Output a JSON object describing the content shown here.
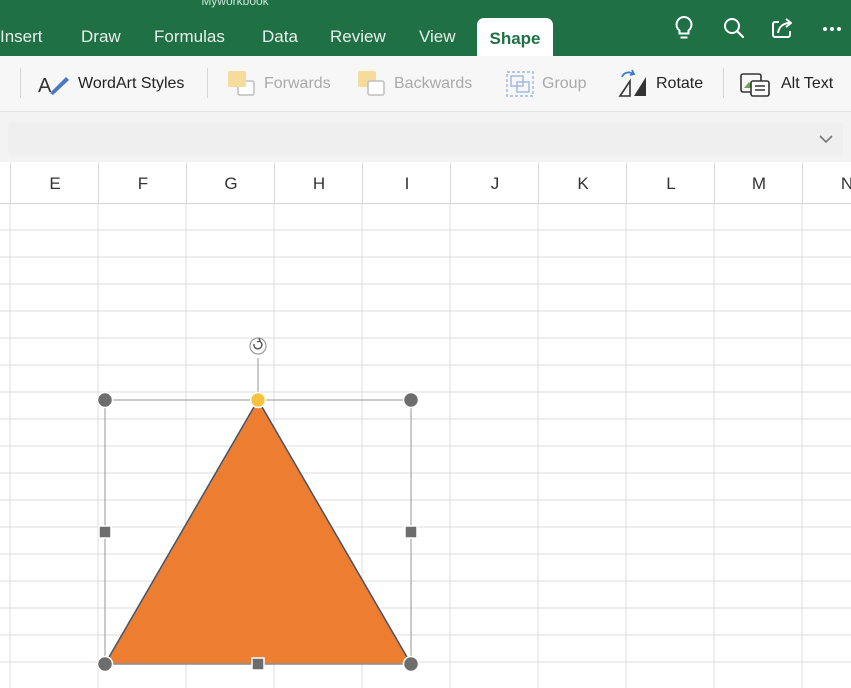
{
  "window": {
    "title": "Myworkbook"
  },
  "tabs": [
    {
      "label": "Insert"
    },
    {
      "label": "Draw"
    },
    {
      "label": "Formulas"
    },
    {
      "label": "Data"
    },
    {
      "label": "Review"
    },
    {
      "label": "View"
    },
    {
      "label": "Shape",
      "active": true
    }
  ],
  "toolbar_icons": [
    "lightbulb-icon",
    "search-icon",
    "share-icon",
    "more-icon"
  ],
  "ribbon": {
    "wordart": "WordArt Styles",
    "forwards": "Forwards",
    "backwards": "Backwards",
    "group": "Group",
    "rotate": "Rotate",
    "alt_text": "Alt Text"
  },
  "formula_bar": {
    "value": ""
  },
  "columns": [
    "E",
    "F",
    "G",
    "H",
    "I",
    "J",
    "K",
    "L",
    "M",
    "N"
  ],
  "shape": {
    "type": "isosceles-triangle",
    "fill": "#ed7d31",
    "outline": "#44546a"
  },
  "colors": {
    "brand": "#1f7145",
    "handle": "#6d6d6d",
    "adjust_handle": "#f5c342"
  }
}
